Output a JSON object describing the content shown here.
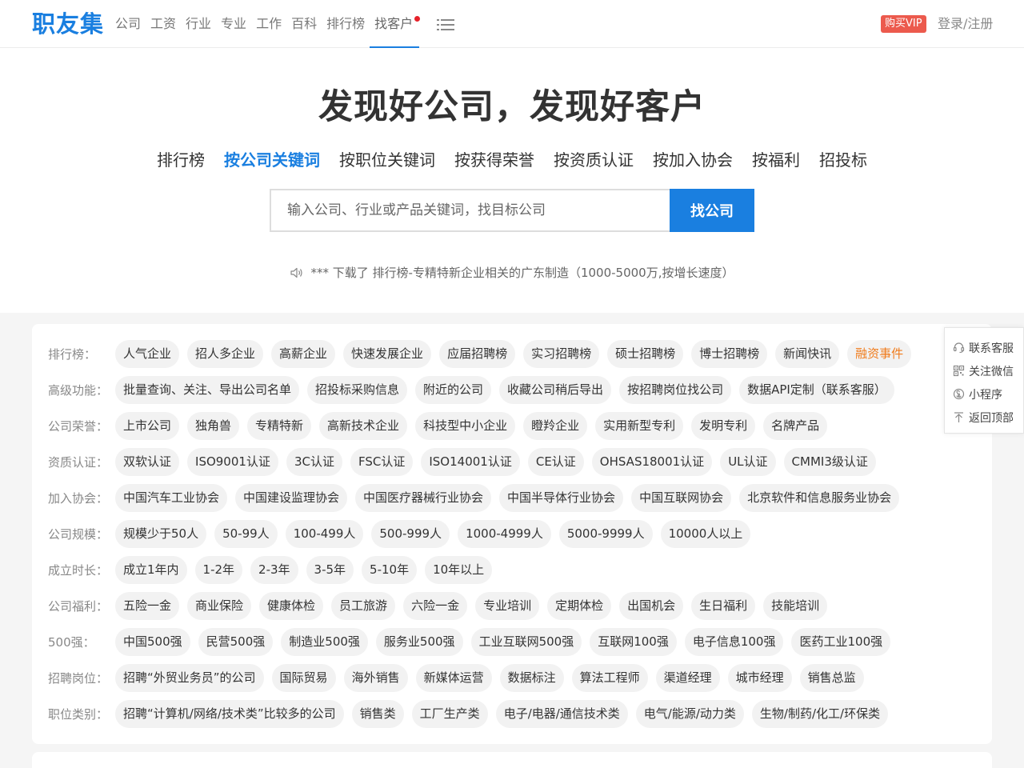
{
  "header": {
    "logo": "职友集",
    "nav": [
      {
        "label": "公司"
      },
      {
        "label": "工资"
      },
      {
        "label": "行业"
      },
      {
        "label": "专业"
      },
      {
        "label": "工作"
      },
      {
        "label": "百科"
      },
      {
        "label": "排行榜"
      },
      {
        "label": "找客户"
      }
    ],
    "vip_label": "购买VIP",
    "login_label": "登录/注册"
  },
  "hero": {
    "title": "发现好公司，发现好客户",
    "tabs": [
      {
        "label": "排行榜"
      },
      {
        "label": "按公司关键词"
      },
      {
        "label": "按职位关键词"
      },
      {
        "label": "按获得荣誉"
      },
      {
        "label": "按资质认证"
      },
      {
        "label": "按加入协会"
      },
      {
        "label": "按福利"
      },
      {
        "label": "招投标"
      }
    ],
    "search_placeholder": "输入公司、行业或产品关键词，找目标公司",
    "search_button": "找公司",
    "notice": "*** 下载了 排行榜-专精特新企业相关的广东制造（1000-5000万,按增长速度）"
  },
  "filters": [
    {
      "label": "排行榜：",
      "items": [
        "人气企业",
        "招人多企业",
        "高薪企业",
        "快速发展企业",
        "应届招聘榜",
        "实习招聘榜",
        "硕士招聘榜",
        "博士招聘榜",
        "新闻快讯",
        "融资事件"
      ]
    },
    {
      "label": "高级功能：",
      "items": [
        "批量查询、关注、导出公司名单",
        "招投标采购信息",
        "附近的公司",
        "收藏公司稍后导出",
        "按招聘岗位找公司",
        "数据API定制（联系客服）"
      ]
    },
    {
      "label": "公司荣誉：",
      "items": [
        "上市公司",
        "独角兽",
        "专精特新",
        "高新技术企业",
        "科技型中小企业",
        "瞪羚企业",
        "实用新型专利",
        "发明专利",
        "名牌产品"
      ]
    },
    {
      "label": "资质认证：",
      "items": [
        "双软认证",
        "ISO9001认证",
        "3C认证",
        "FSC认证",
        "ISO14001认证",
        "CE认证",
        "OHSAS18001认证",
        "UL认证",
        "CMMI3级认证"
      ]
    },
    {
      "label": "加入协会：",
      "items": [
        "中国汽车工业协会",
        "中国建设监理协会",
        "中国医疗器械行业协会",
        "中国半导体行业协会",
        "中国互联网协会",
        "北京软件和信息服务业协会"
      ]
    },
    {
      "label": "公司规模：",
      "items": [
        "规模少于50人",
        "50-99人",
        "100-499人",
        "500-999人",
        "1000-4999人",
        "5000-9999人",
        "10000人以上"
      ]
    },
    {
      "label": "成立时长：",
      "items": [
        "成立1年内",
        "1-2年",
        "2-3年",
        "3-5年",
        "5-10年",
        "10年以上"
      ]
    },
    {
      "label": "公司福利：",
      "items": [
        "五险一金",
        "商业保险",
        "健康体检",
        "员工旅游",
        "六险一金",
        "专业培训",
        "定期体检",
        "出国机会",
        "生日福利",
        "技能培训"
      ]
    },
    {
      "label": "500强：",
      "items": [
        "中国500强",
        "民营500强",
        "制造业500强",
        "服务业500强",
        "工业互联网500强",
        "互联网100强",
        "电子信息100强",
        "医药工业100强"
      ]
    },
    {
      "label": "招聘岗位：",
      "items": [
        "招聘“外贸业务员”的公司",
        "国际贸易",
        "海外销售",
        "新媒体运营",
        "数据标注",
        "算法工程师",
        "渠道经理",
        "城市经理",
        "销售总监"
      ]
    },
    {
      "label": "职位类别：",
      "items": [
        "招聘“计算机/网络/技术类”比较多的公司",
        "销售类",
        "工厂生产类",
        "电子/电器/通信技术类",
        "电气/能源/动力类",
        "生物/制药/化工/环保类"
      ]
    }
  ],
  "side_float": [
    {
      "label": "联系客服",
      "icon": "headset-icon"
    },
    {
      "label": "关注微信",
      "icon": "qrcode-icon"
    },
    {
      "label": "小程序",
      "icon": "miniprogram-icon"
    },
    {
      "label": "返回顶部",
      "icon": "back-to-top-icon"
    }
  ],
  "colors": {
    "brand": "#1a7fe0",
    "vip": "#ec5a4d",
    "hot": "#f07c1d",
    "dot": "#e6212a"
  }
}
